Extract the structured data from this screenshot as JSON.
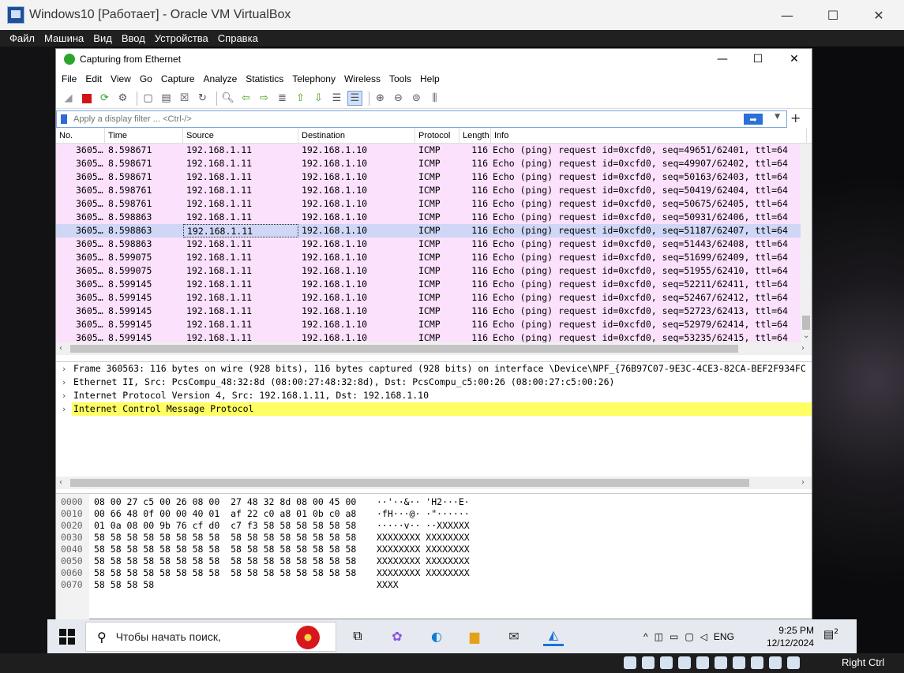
{
  "vbox": {
    "title": "Windows10 [Работает] - Oracle VM VirtualBox",
    "menu": [
      "Файл",
      "Машина",
      "Вид",
      "Ввод",
      "Устройства",
      "Справка"
    ],
    "right_ctrl": "Right Ctrl"
  },
  "wireshark": {
    "title": "Capturing from Ethernet",
    "menu": [
      "File",
      "Edit",
      "View",
      "Go",
      "Capture",
      "Analyze",
      "Statistics",
      "Telephony",
      "Wireless",
      "Tools",
      "Help"
    ],
    "filter_placeholder": "Apply a display filter ... <Ctrl-/>",
    "columns": [
      "No.",
      "Time",
      "Source",
      "Destination",
      "Protocol",
      "Length",
      "Info"
    ],
    "packets": [
      {
        "no": "3605…",
        "time": "8.598671",
        "src": "192.168.1.11",
        "dst": "192.168.1.10",
        "proto": "ICMP",
        "len": "116",
        "info": "Echo (ping) request  id=0xcfd0, seq=49651/62401, ttl=64"
      },
      {
        "no": "3605…",
        "time": "8.598671",
        "src": "192.168.1.11",
        "dst": "192.168.1.10",
        "proto": "ICMP",
        "len": "116",
        "info": "Echo (ping) request  id=0xcfd0, seq=49907/62402, ttl=64"
      },
      {
        "no": "3605…",
        "time": "8.598671",
        "src": "192.168.1.11",
        "dst": "192.168.1.10",
        "proto": "ICMP",
        "len": "116",
        "info": "Echo (ping) request  id=0xcfd0, seq=50163/62403, ttl=64"
      },
      {
        "no": "3605…",
        "time": "8.598761",
        "src": "192.168.1.11",
        "dst": "192.168.1.10",
        "proto": "ICMP",
        "len": "116",
        "info": "Echo (ping) request  id=0xcfd0, seq=50419/62404, ttl=64"
      },
      {
        "no": "3605…",
        "time": "8.598761",
        "src": "192.168.1.11",
        "dst": "192.168.1.10",
        "proto": "ICMP",
        "len": "116",
        "info": "Echo (ping) request  id=0xcfd0, seq=50675/62405, ttl=64"
      },
      {
        "no": "3605…",
        "time": "8.598863",
        "src": "192.168.1.11",
        "dst": "192.168.1.10",
        "proto": "ICMP",
        "len": "116",
        "info": "Echo (ping) request  id=0xcfd0, seq=50931/62406, ttl=64"
      },
      {
        "no": "3605…",
        "time": "8.598863",
        "src": "192.168.1.11",
        "dst": "192.168.1.10",
        "proto": "ICMP",
        "len": "116",
        "info": "Echo (ping) request  id=0xcfd0, seq=51187/62407, ttl=64",
        "selected": true
      },
      {
        "no": "3605…",
        "time": "8.598863",
        "src": "192.168.1.11",
        "dst": "192.168.1.10",
        "proto": "ICMP",
        "len": "116",
        "info": "Echo (ping) request  id=0xcfd0, seq=51443/62408, ttl=64"
      },
      {
        "no": "3605…",
        "time": "8.599075",
        "src": "192.168.1.11",
        "dst": "192.168.1.10",
        "proto": "ICMP",
        "len": "116",
        "info": "Echo (ping) request  id=0xcfd0, seq=51699/62409, ttl=64"
      },
      {
        "no": "3605…",
        "time": "8.599075",
        "src": "192.168.1.11",
        "dst": "192.168.1.10",
        "proto": "ICMP",
        "len": "116",
        "info": "Echo (ping) request  id=0xcfd0, seq=51955/62410, ttl=64"
      },
      {
        "no": "3605…",
        "time": "8.599145",
        "src": "192.168.1.11",
        "dst": "192.168.1.10",
        "proto": "ICMP",
        "len": "116",
        "info": "Echo (ping) request  id=0xcfd0, seq=52211/62411, ttl=64"
      },
      {
        "no": "3605…",
        "time": "8.599145",
        "src": "192.168.1.11",
        "dst": "192.168.1.10",
        "proto": "ICMP",
        "len": "116",
        "info": "Echo (ping) request  id=0xcfd0, seq=52467/62412, ttl=64"
      },
      {
        "no": "3605…",
        "time": "8.599145",
        "src": "192.168.1.11",
        "dst": "192.168.1.10",
        "proto": "ICMP",
        "len": "116",
        "info": "Echo (ping) request  id=0xcfd0, seq=52723/62413, ttl=64"
      },
      {
        "no": "3605…",
        "time": "8.599145",
        "src": "192.168.1.11",
        "dst": "192.168.1.10",
        "proto": "ICMP",
        "len": "116",
        "info": "Echo (ping) request  id=0xcfd0, seq=52979/62414, ttl=64"
      },
      {
        "no": "3605…",
        "time": "8.599145",
        "src": "192.168.1.11",
        "dst": "192.168.1.10",
        "proto": "ICMP",
        "len": "116",
        "info": "Echo (ping) request  id=0xcfd0, seq=53235/62415, ttl=64"
      }
    ],
    "details": [
      {
        "text": "Frame 360563: 116 bytes on wire (928 bits), 116 bytes captured (928 bits) on interface \\Device\\NPF_{76B97C07-9E3C-4CE3-82CA-BEF2F934FC",
        "highlight": false
      },
      {
        "text": "Ethernet II, Src: PcsCompu_48:32:8d (08:00:27:48:32:8d), Dst: PcsCompu_c5:00:26 (08:00:27:c5:00:26)",
        "highlight": false
      },
      {
        "text": "Internet Protocol Version 4, Src: 192.168.1.11, Dst: 192.168.1.10",
        "highlight": false
      },
      {
        "text": "Internet Control Message Protocol",
        "highlight": true
      }
    ],
    "bytes": [
      {
        "off": "0000",
        "hex": "08 00 27 c5 00 26 08 00  27 48 32 8d 08 00 45 00",
        "ascii": "··'··&·· 'H2···E·"
      },
      {
        "off": "0010",
        "hex": "00 66 48 0f 00 00 40 01  af 22 c0 a8 01 0b c0 a8",
        "ascii": "·fH···@· ·\"······"
      },
      {
        "off": "0020",
        "hex": "01 0a 08 00 9b 76 cf d0  c7 f3 58 58 58 58 58 58",
        "ascii": "·····v·· ··XXXXXX"
      },
      {
        "off": "0030",
        "hex": "58 58 58 58 58 58 58 58  58 58 58 58 58 58 58 58",
        "ascii": "XXXXXXXX XXXXXXXX"
      },
      {
        "off": "0040",
        "hex": "58 58 58 58 58 58 58 58  58 58 58 58 58 58 58 58",
        "ascii": "XXXXXXXX XXXXXXXX"
      },
      {
        "off": "0050",
        "hex": "58 58 58 58 58 58 58 58  58 58 58 58 58 58 58 58",
        "ascii": "XXXXXXXX XXXXXXXX"
      },
      {
        "off": "0060",
        "hex": "58 58 58 58 58 58 58 58  58 58 58 58 58 58 58 58",
        "ascii": "XXXXXXXX XXXXXXXX"
      },
      {
        "off": "0070",
        "hex": "58 58 58 58",
        "ascii": "XXXX"
      }
    ]
  },
  "taskbar": {
    "search_placeholder": "Чтобы начать поиск,",
    "lang": "ENG",
    "time": "9:25 PM",
    "date": "12/12/2024",
    "notification_count": "2"
  },
  "colors": {
    "row_bg": "#fbe1fb",
    "row_selected": "#cfd6f6",
    "detail_highlight": "#ffff64",
    "accent": "#2b6fd7"
  }
}
